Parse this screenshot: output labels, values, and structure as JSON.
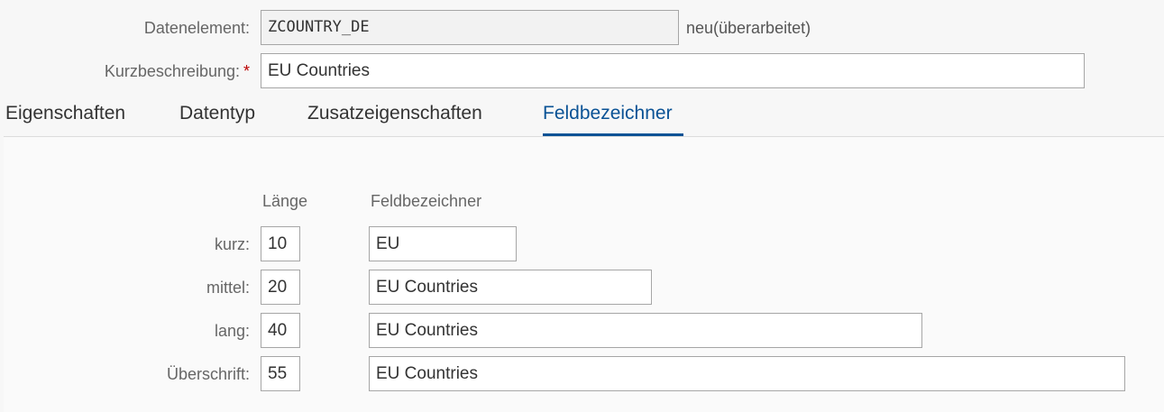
{
  "header": {
    "data_element_label": "Datenelement:",
    "data_element_value": "ZCOUNTRY_DE",
    "status": "neu(überarbeitet)",
    "short_desc_label": "Kurzbeschreibung:",
    "required_marker": "*",
    "short_desc_value": "EU Countries"
  },
  "tabs": [
    {
      "label": "Eigenschaften",
      "active": false
    },
    {
      "label": "Datentyp",
      "active": false
    },
    {
      "label": "Zusatzeigenschaften",
      "active": false
    },
    {
      "label": "Feldbezeichner",
      "active": true
    }
  ],
  "field_labels": {
    "col_length": "Länge",
    "col_label": "Feldbezeichner",
    "rows": [
      {
        "label": "kurz:",
        "length": "10",
        "text": "EU"
      },
      {
        "label": "mittel:",
        "length": "20",
        "text": "EU Countries"
      },
      {
        "label": "lang:",
        "length": "40",
        "text": "EU Countries"
      },
      {
        "label": "Überschrift:",
        "length": "55",
        "text": "EU Countries"
      }
    ]
  },
  "colors": {
    "accent": "#0a5295",
    "required": "#bb0000"
  }
}
